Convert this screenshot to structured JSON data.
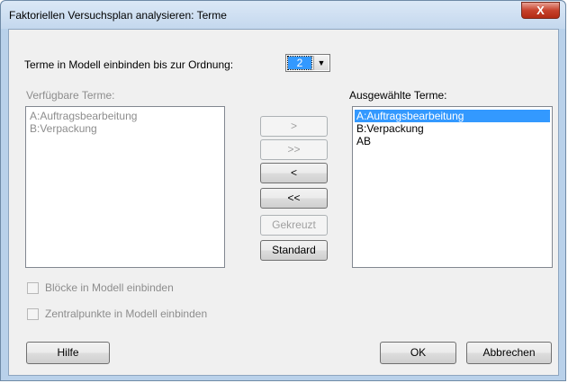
{
  "window": {
    "title": "Faktoriellen Versuchsplan analysieren: Terme",
    "close_label": "X"
  },
  "order": {
    "label": "Terme in Modell einbinden bis zur Ordnung:",
    "value": "2",
    "arrow": "▼"
  },
  "available": {
    "label": "Verfügbare Terme:",
    "items": [
      "A:Auftragsbearbeitung",
      "B:Verpackung"
    ]
  },
  "selected": {
    "label": "Ausgewählte Terme:",
    "items": [
      "A:Auftragsbearbeitung",
      "B:Verpackung",
      "AB"
    ]
  },
  "move_buttons": {
    "add_one": ">",
    "add_all": ">>",
    "remove_one": "<",
    "remove_all": "<<",
    "crossed": "Gekreuzt",
    "default": "Standard"
  },
  "options": {
    "blocks": "Blöcke in Modell einbinden",
    "center_points": "Zentralpunkte in Modell einbinden"
  },
  "footer": {
    "help": "Hilfe",
    "ok": "OK",
    "cancel": "Abbrechen"
  }
}
